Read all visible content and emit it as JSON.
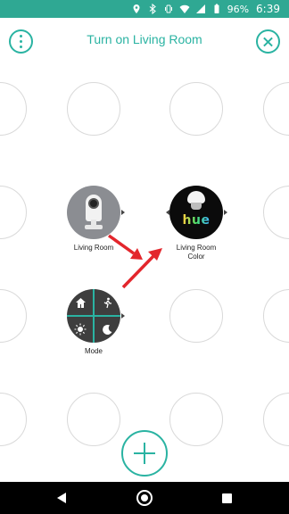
{
  "status_bar": {
    "battery": "96%",
    "time": "6:39"
  },
  "header": {
    "title": "Turn on Living Room"
  },
  "nodes": {
    "camera": {
      "label": "Living Room",
      "icon": "nest-camera-icon"
    },
    "hue": {
      "label_line1": "Living Room",
      "label_line2": "Color",
      "logo_text": "hue",
      "icon": "hue-bulb-icon"
    },
    "mode": {
      "label": "Mode",
      "icons": [
        "home-icon",
        "walking-person-icon",
        "sun-icon",
        "moon-icon"
      ]
    }
  },
  "colors": {
    "accent": "#2ab3a2",
    "status_bar": "#2fa893",
    "arrow": "#e3262c"
  }
}
